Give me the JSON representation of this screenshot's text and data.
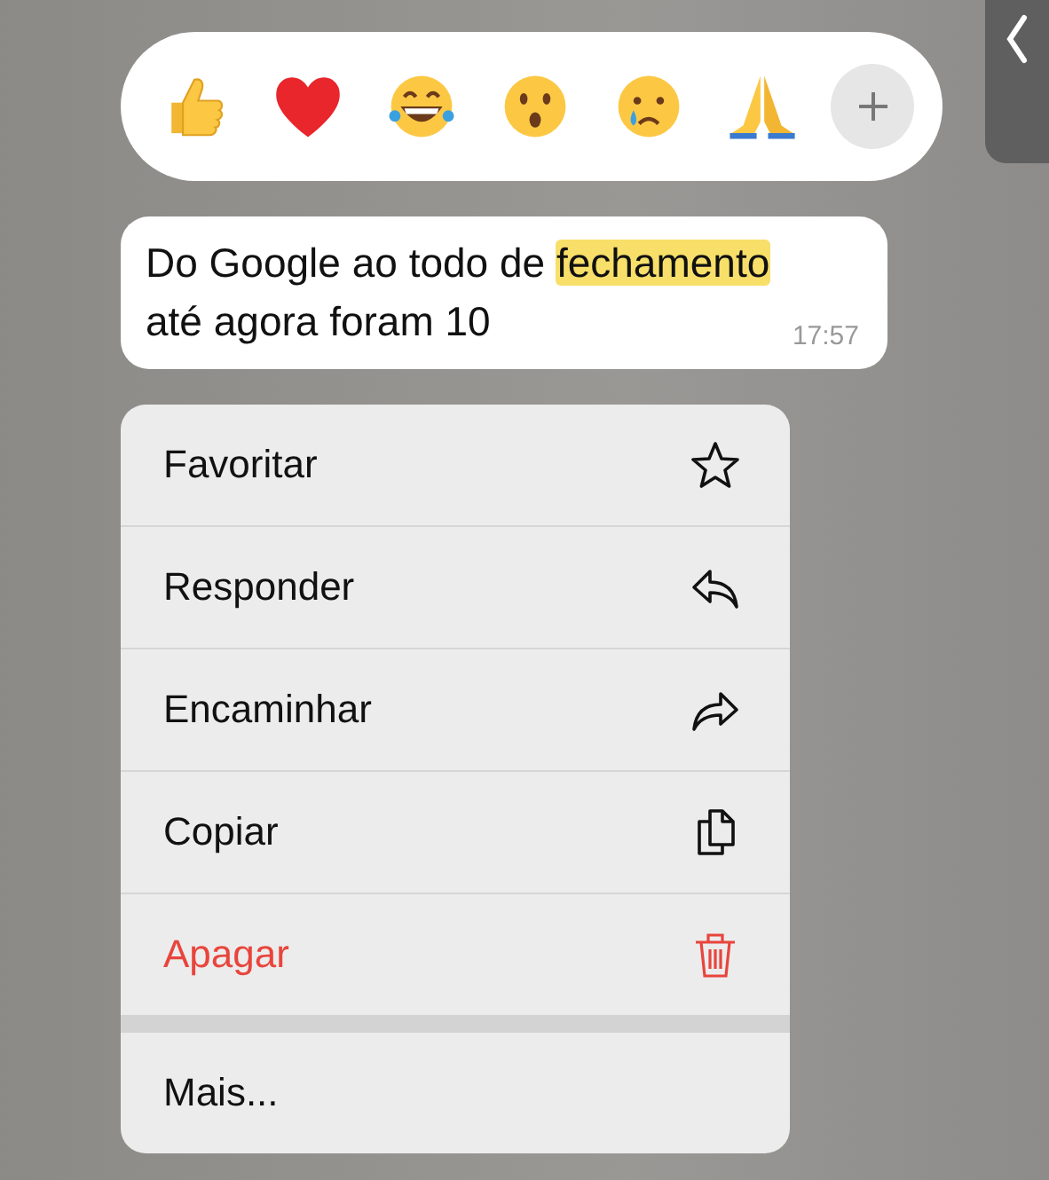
{
  "message": {
    "parts": [
      {
        "text": "Do Google ao todo de ",
        "highlighted": false
      },
      {
        "text": "fechamento",
        "highlighted": true
      },
      {
        "text": " até agora foram 10",
        "highlighted": false
      }
    ],
    "time": "17:57"
  },
  "menu": {
    "groups": [
      [
        {
          "label": "Favoritar",
          "destructive": false
        },
        {
          "label": "Responder",
          "destructive": false
        },
        {
          "label": "Encaminhar",
          "destructive": false
        },
        {
          "label": "Copiar",
          "destructive": false
        },
        {
          "label": "Apagar",
          "destructive": true
        }
      ],
      [
        {
          "label": "Mais...",
          "destructive": false
        }
      ]
    ]
  }
}
